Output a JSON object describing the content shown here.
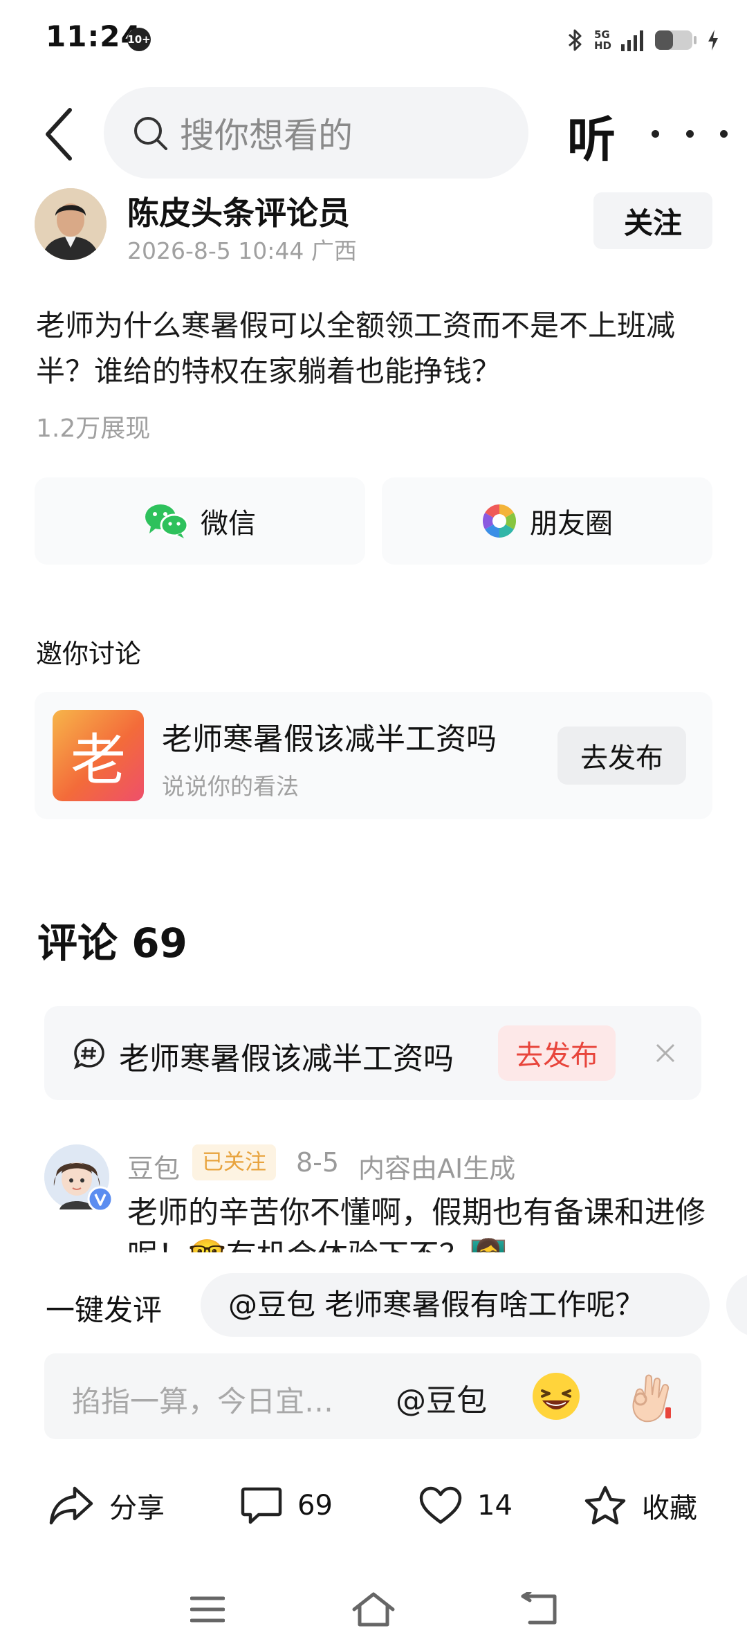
{
  "status_bar": {
    "time": "11:24",
    "notification_badge": "10+",
    "network_label_top": "5G",
    "network_label_hd": "HD"
  },
  "header": {
    "search_placeholder": "搜你想看的",
    "listen_label": "听"
  },
  "author": {
    "name": "陈皮头条评论员",
    "meta": "2026-8-5 10:44 广西",
    "follow_label": "关注"
  },
  "post": {
    "text": "老师为什么寒暑假可以全额领工资而不是不上班减半？谁给的特权在家躺着也能挣钱？",
    "views": "1.2万展现"
  },
  "share": {
    "wechat_label": "微信",
    "moments_label": "朋友圈"
  },
  "invite": {
    "title": "邀你讨论",
    "thumb_char": "老",
    "topic": "老师寒暑假该减半工资吗",
    "subtitle": "说说你的看法",
    "publish_label": "去发布"
  },
  "comments": {
    "title": "评论 69",
    "banner_topic": "老师寒暑假该减半工资吗",
    "banner_publish_label": "去发布",
    "first": {
      "author": "豆包",
      "follow_tag": "已关注",
      "date": "8-5",
      "ai_note": "内容由AI生成",
      "text": "老师的辛苦你不懂啊，假期也有备课和进修呢！🤓有机会体验下不？👩‍🏫"
    }
  },
  "quick_comment": {
    "label": "一键发评",
    "suggestion": "@豆包 老师寒暑假有啥工作呢？"
  },
  "comment_input": {
    "placeholder": "掐指一算，今日宜…",
    "mention": "@豆包"
  },
  "actions": {
    "share_label": "分享",
    "comment_count": "69",
    "like_count": "14",
    "favorite_label": "收藏"
  },
  "colors": {
    "accent_red": "#e8453c",
    "follow_tag_orange": "#e8a33d",
    "wechat_green": "#2ec15c",
    "muted_text": "#a0a0a0"
  }
}
